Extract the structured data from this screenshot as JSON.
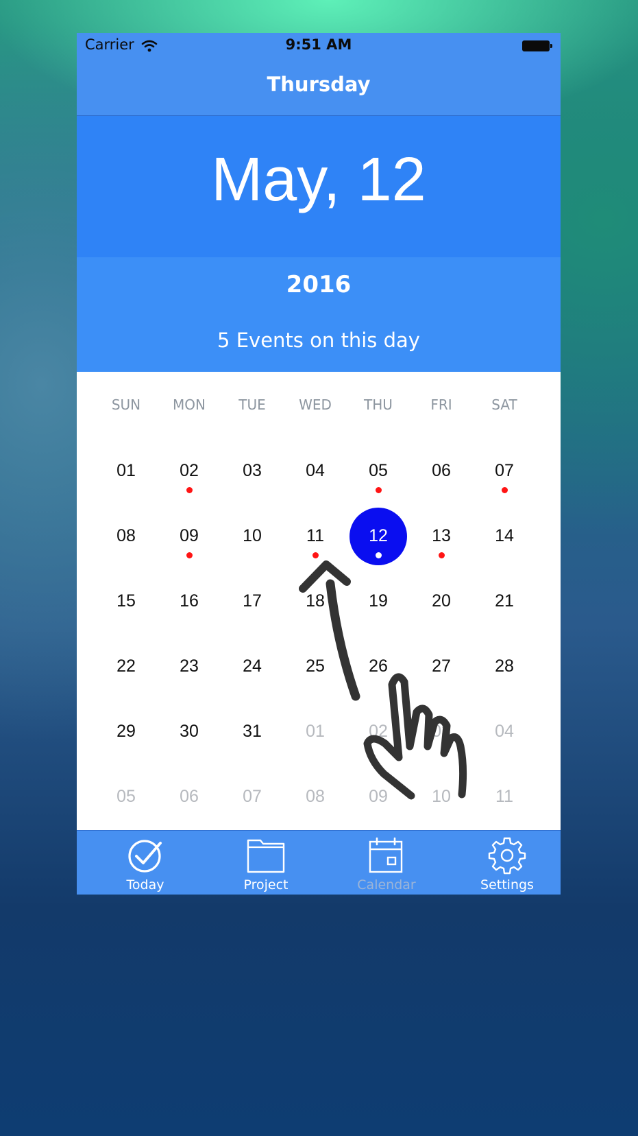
{
  "status_bar": {
    "carrier": "Carrier",
    "time": "9:51 AM"
  },
  "nav": {
    "title": "Thursday"
  },
  "header": {
    "date": "May, 12",
    "year": "2016",
    "events": "5 Events on this day"
  },
  "calendar": {
    "weekdays": [
      "SUN",
      "MON",
      "TUE",
      "WED",
      "THU",
      "FRI",
      "SAT"
    ],
    "weeks": [
      [
        {
          "n": "01"
        },
        {
          "n": "02",
          "dot": true
        },
        {
          "n": "03"
        },
        {
          "n": "04"
        },
        {
          "n": "05",
          "dot": true
        },
        {
          "n": "06"
        },
        {
          "n": "07",
          "dot": true
        }
      ],
      [
        {
          "n": "08"
        },
        {
          "n": "09",
          "dot": true
        },
        {
          "n": "10"
        },
        {
          "n": "11",
          "dot": true
        },
        {
          "n": "12",
          "dot": true,
          "selected": true
        },
        {
          "n": "13",
          "dot": true
        },
        {
          "n": "14"
        }
      ],
      [
        {
          "n": "15"
        },
        {
          "n": "16"
        },
        {
          "n": "17"
        },
        {
          "n": "18"
        },
        {
          "n": "19"
        },
        {
          "n": "20"
        },
        {
          "n": "21"
        }
      ],
      [
        {
          "n": "22"
        },
        {
          "n": "23"
        },
        {
          "n": "24"
        },
        {
          "n": "25"
        },
        {
          "n": "26"
        },
        {
          "n": "27"
        },
        {
          "n": "28"
        }
      ],
      [
        {
          "n": "29"
        },
        {
          "n": "30"
        },
        {
          "n": "31"
        },
        {
          "n": "01",
          "other": true
        },
        {
          "n": "02",
          "other": true
        },
        {
          "n": "03",
          "other": true
        },
        {
          "n": "04",
          "other": true
        }
      ],
      [
        {
          "n": "05",
          "other": true
        },
        {
          "n": "06",
          "other": true
        },
        {
          "n": "07",
          "other": true
        },
        {
          "n": "08",
          "other": true
        },
        {
          "n": "09",
          "other": true
        },
        {
          "n": "10",
          "other": true
        },
        {
          "n": "11",
          "other": true
        }
      ]
    ]
  },
  "tabs": [
    {
      "label": "Today",
      "icon": "checkmark-circle-icon",
      "active": true
    },
    {
      "label": "Project",
      "icon": "folder-icon",
      "active": true
    },
    {
      "label": "Calendar",
      "icon": "calendar-icon",
      "active": false
    },
    {
      "label": "Settings",
      "icon": "gear-icon",
      "active": true
    }
  ],
  "colors": {
    "primary": "#4790f1",
    "date_band": "#2f83f6",
    "year_band": "#3c8ff7",
    "selected": "#0a0ef0",
    "event_dot": "#ff1414"
  }
}
